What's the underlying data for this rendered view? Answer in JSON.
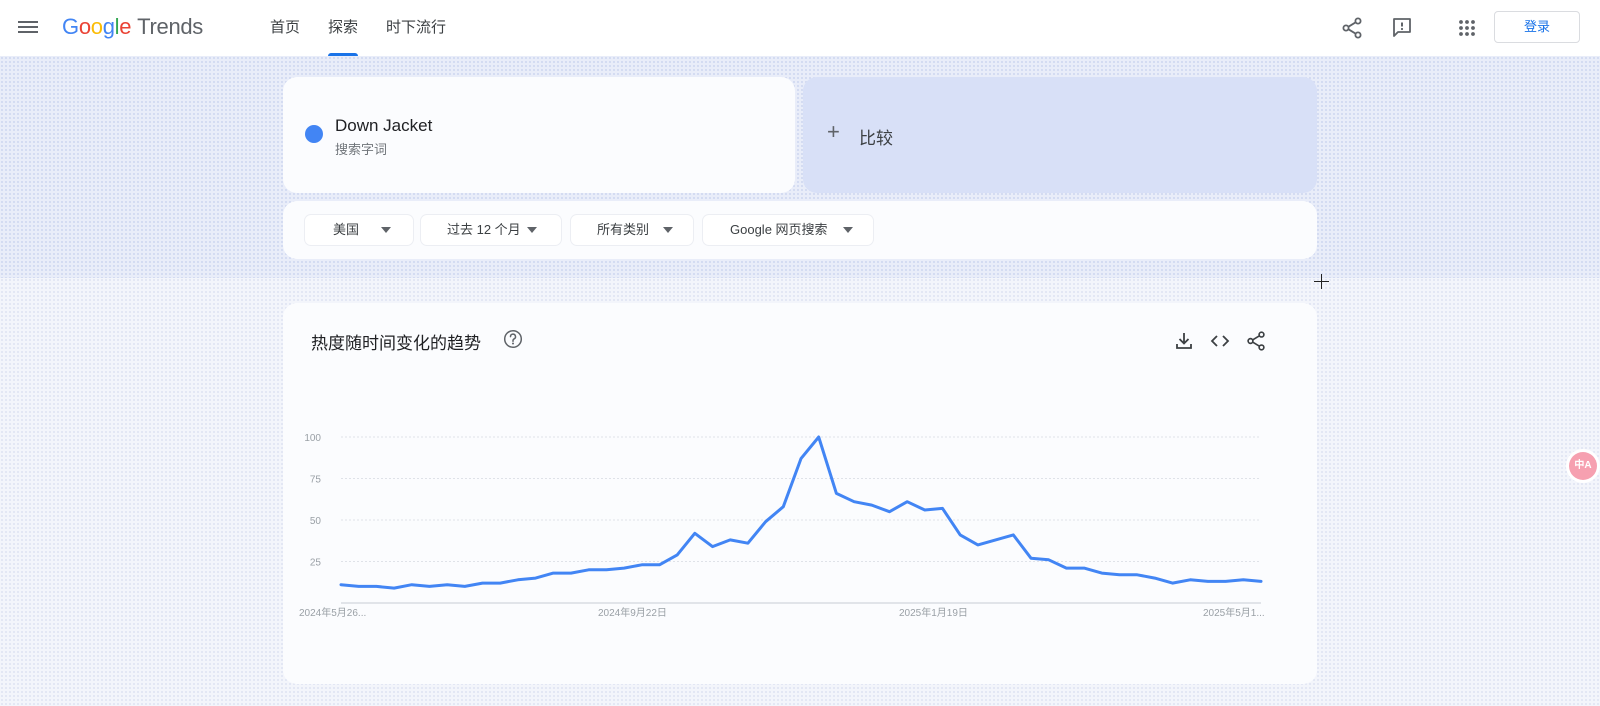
{
  "header": {
    "logo_letters": [
      "G",
      "o",
      "o",
      "g",
      "l",
      "e"
    ],
    "logo_product": "Trends",
    "nav": [
      {
        "label": "首页",
        "active": false
      },
      {
        "label": "探索",
        "active": true
      },
      {
        "label": "时下流行",
        "active": false
      }
    ],
    "login_label": "登录",
    "icons": [
      "share-icon",
      "feedback-icon",
      "apps-icon"
    ]
  },
  "search": {
    "term": "Down Jacket",
    "term_type": "搜索字词",
    "term_color": "#4285f4",
    "compare_label": "比较"
  },
  "filters": [
    {
      "label": "美国"
    },
    {
      "label": "过去 12 个月"
    },
    {
      "label": "所有类别"
    },
    {
      "label": "Google 网页搜索"
    }
  ],
  "chart_card": {
    "title": "热度随时间变化的趋势",
    "icons": [
      "download-icon",
      "embed-icon",
      "share-icon"
    ]
  },
  "translate_badge": "中A",
  "chart_data": {
    "type": "line",
    "title": "热度随时间变化的趋势",
    "xlabel": "",
    "ylabel": "",
    "ylim": [
      0,
      100
    ],
    "yticks": [
      25,
      50,
      75,
      100
    ],
    "xtick_labels": [
      "2024年5月26...",
      "2024年9月22日",
      "2025年1月19日",
      "2025年5月1..."
    ],
    "grid": true,
    "line_color": "#4285f4",
    "series": [
      {
        "name": "Down Jacket",
        "values": [
          11,
          10,
          10,
          9,
          11,
          10,
          11,
          10,
          12,
          12,
          14,
          15,
          18,
          18,
          20,
          20,
          21,
          23,
          23,
          29,
          42,
          34,
          38,
          36,
          49,
          58,
          87,
          100,
          66,
          61,
          59,
          55,
          61,
          56,
          57,
          41,
          35,
          38,
          41,
          27,
          26,
          21,
          21,
          18,
          17,
          17,
          15,
          12,
          14,
          13,
          13,
          14,
          13
        ]
      }
    ]
  }
}
